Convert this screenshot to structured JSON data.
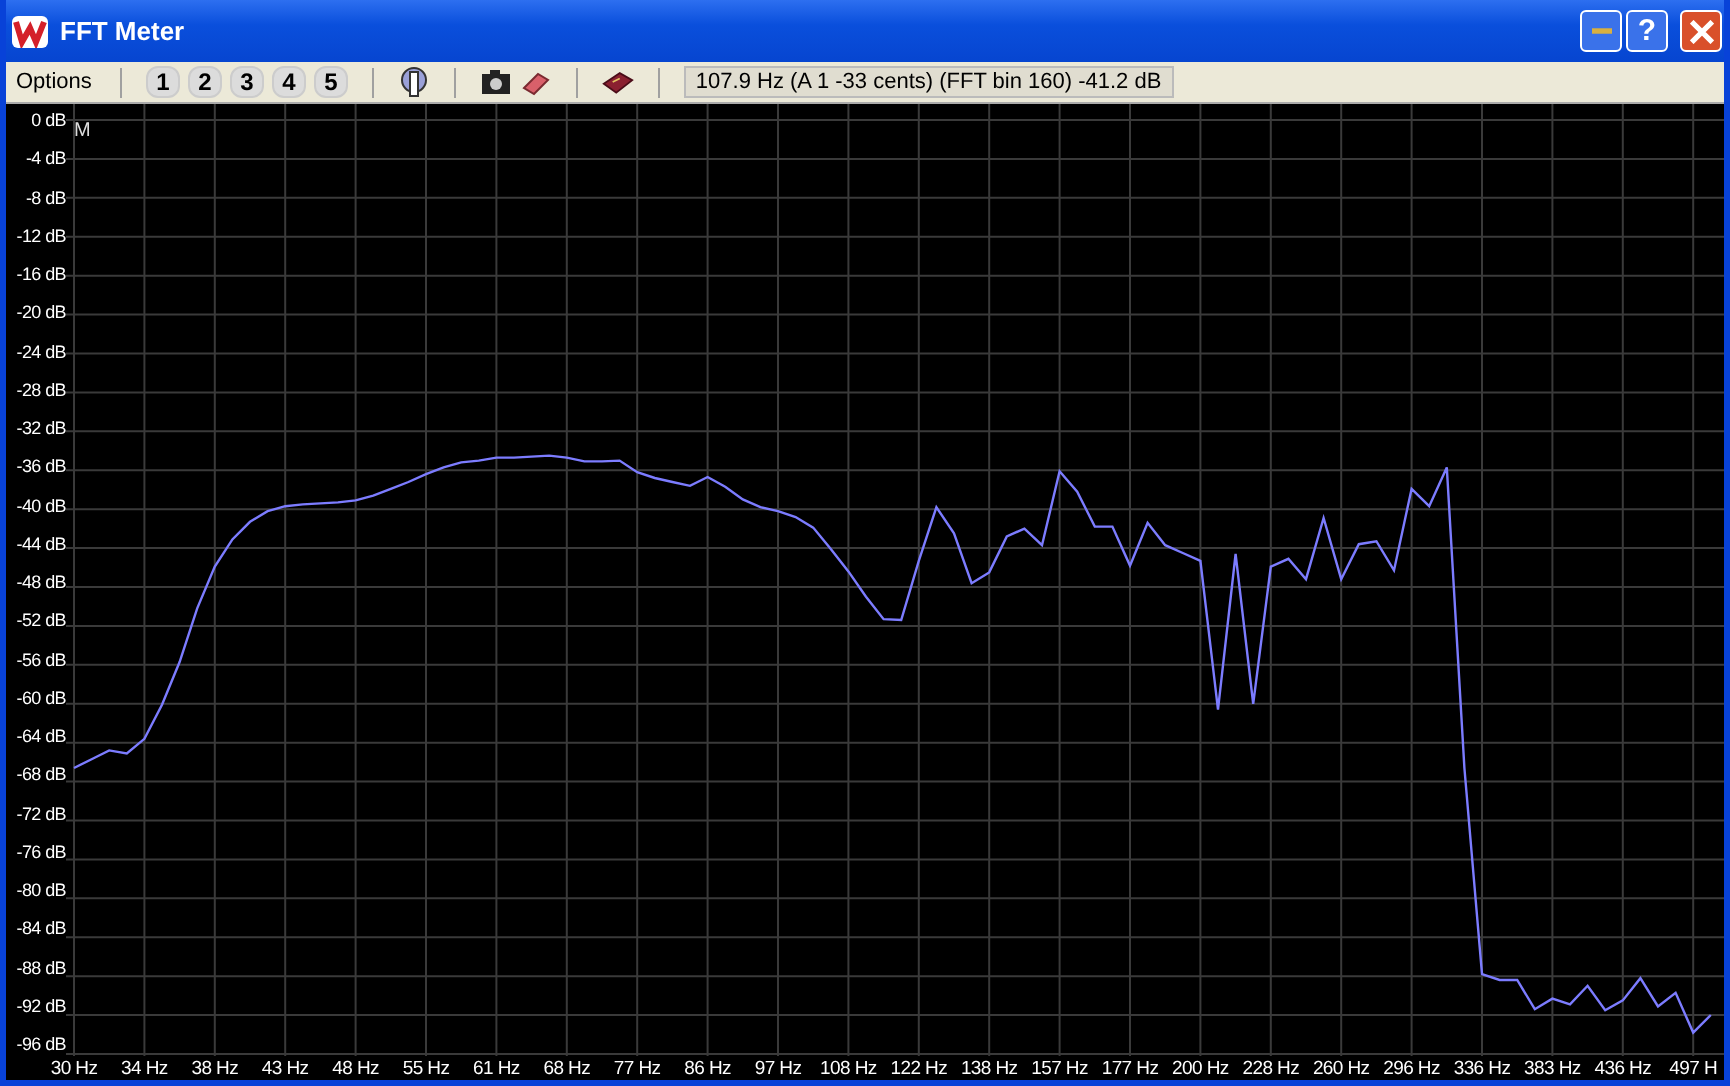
{
  "window": {
    "title": "FFT Meter",
    "help_button": "?"
  },
  "toolbar": {
    "menu": "Options",
    "presets": [
      "1",
      "2",
      "3",
      "4",
      "5"
    ],
    "readout": "107.9 Hz (A 1 -33 cents) (FFT bin 160) -41.2 dB"
  },
  "plot": {
    "chart_data": {
      "type": "line",
      "ylim": [
        -96,
        0
      ],
      "grid": true,
      "yticks": [
        {
          "value": 0,
          "label": "0 dB"
        },
        {
          "value": -4,
          "label": "-4 dB"
        },
        {
          "value": -8,
          "label": "-8 dB"
        },
        {
          "value": -12,
          "label": "-12 dB"
        },
        {
          "value": -16,
          "label": "-16 dB"
        },
        {
          "value": -20,
          "label": "-20 dB"
        },
        {
          "value": -24,
          "label": "-24 dB"
        },
        {
          "value": -28,
          "label": "-28 dB"
        },
        {
          "value": -32,
          "label": "-32 dB"
        },
        {
          "value": -36,
          "label": "-36 dB"
        },
        {
          "value": -40,
          "label": "-40 dB"
        },
        {
          "value": -44,
          "label": "-44 dB"
        },
        {
          "value": -48,
          "label": "-48 dB"
        },
        {
          "value": -52,
          "label": "-52 dB"
        },
        {
          "value": -56,
          "label": "-56 dB"
        },
        {
          "value": -60,
          "label": "-60 dB"
        },
        {
          "value": -64,
          "label": "-64 dB"
        },
        {
          "value": -68,
          "label": "-68 dB"
        },
        {
          "value": -72,
          "label": "-72 dB"
        },
        {
          "value": -76,
          "label": "-76 dB"
        },
        {
          "value": -80,
          "label": "-80 dB"
        },
        {
          "value": -84,
          "label": "-84 dB"
        },
        {
          "value": -88,
          "label": "-88 dB"
        },
        {
          "value": -92,
          "label": "-92 dB"
        },
        {
          "value": -96,
          "label": "-96 dB"
        }
      ],
      "categories": [
        "30 Hz",
        null,
        null,
        null,
        "34 Hz",
        null,
        null,
        null,
        "38 Hz",
        null,
        null,
        null,
        "43 Hz",
        null,
        null,
        null,
        "48 Hz",
        null,
        null,
        null,
        "55 Hz",
        null,
        null,
        null,
        "61 Hz",
        null,
        null,
        null,
        "68 Hz",
        null,
        null,
        null,
        "77 Hz",
        null,
        null,
        null,
        "86 Hz",
        null,
        null,
        null,
        "97 Hz",
        null,
        null,
        null,
        "108 Hz",
        null,
        null,
        null,
        "122 Hz",
        null,
        null,
        null,
        "138 Hz",
        null,
        null,
        null,
        "157 Hz",
        null,
        null,
        null,
        "177 Hz",
        null,
        null,
        null,
        "200 Hz",
        null,
        null,
        null,
        "228 Hz",
        null,
        null,
        null,
        "260 Hz",
        null,
        null,
        null,
        "296 Hz",
        null,
        null,
        null,
        "336 Hz",
        null,
        null,
        null,
        "383 Hz",
        null,
        null,
        null,
        "436 Hz",
        null,
        null,
        null,
        "497 H",
        null
      ],
      "series": [
        {
          "name": "M",
          "color": "#7c7cff",
          "values": [
            -66.6,
            -65.7,
            -64.8,
            -65.1,
            -63.6,
            -60.1,
            -55.7,
            -50.2,
            -45.9,
            -43.1,
            -41.3,
            -40.2,
            -39.7,
            -39.5,
            -39.4,
            -39.3,
            -39.1,
            -38.6,
            -37.9,
            -37.2,
            -36.4,
            -35.7,
            -35.2,
            -35.0,
            -34.7,
            -34.7,
            -34.6,
            -34.5,
            -34.7,
            -35.1,
            -35.1,
            -35.0,
            -36.2,
            -36.8,
            -37.2,
            -37.6,
            -36.7,
            -37.7,
            -39.0,
            -39.8,
            -40.2,
            -40.8,
            -41.9,
            -44.1,
            -46.4,
            -49.0,
            -51.3,
            -51.4,
            -45.3,
            -39.8,
            -42.5,
            -47.6,
            -46.5,
            -42.8,
            -42.0,
            -43.7,
            -36.1,
            -38.2,
            -41.8,
            -41.8,
            -45.8,
            -41.4,
            -43.7,
            -44.5,
            -45.3,
            -60.6,
            -44.6,
            -60.0,
            -45.9,
            -45.1,
            -47.2,
            -40.9,
            -47.2,
            -43.6,
            -43.3,
            -46.3,
            -37.9,
            -39.7,
            -35.7,
            -66.6,
            -87.8,
            -88.4,
            -88.4,
            -91.4,
            -90.3,
            -90.9,
            -89.0,
            -91.5,
            -90.5,
            -88.2,
            -91.1,
            -89.7,
            -93.8,
            -92.0
          ]
        }
      ]
    }
  }
}
